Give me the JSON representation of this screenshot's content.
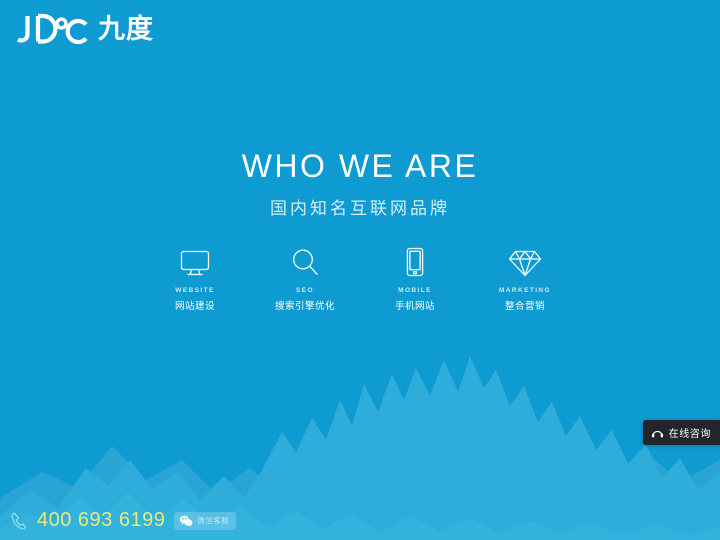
{
  "theme": {
    "background": "#0e9bd2",
    "mountain_back": "#2ba6d6",
    "mountain_front": "#2eaddb",
    "text_white": "#ffffff",
    "phone_yellow": "#e9e97a",
    "chat_panel": "#22252b"
  },
  "logo": {
    "mark_text": "JD°C",
    "mark_icon": "jdc-logo-icon",
    "cn_text": "九度"
  },
  "hero": {
    "title": "WHO WE ARE",
    "subtitle": "国内知名互联网品牌"
  },
  "services": [
    {
      "icon": "monitor-icon",
      "en": "WEBSITE",
      "cn": "网站建设"
    },
    {
      "icon": "search-icon",
      "en": "SEO",
      "cn": "搜索引擎优化"
    },
    {
      "icon": "mobile-icon",
      "en": "MOBILE",
      "cn": "手机网站"
    },
    {
      "icon": "diamond-icon",
      "en": "MARKETING",
      "cn": "整合营销"
    }
  ],
  "bottom_bar": {
    "phone_icon": "phone-icon",
    "phone_number": "400 693 6199",
    "wechat_icon": "wechat-icon",
    "wechat_label": "微信客服"
  },
  "chat_widget": {
    "icon": "headset-icon",
    "label": "在线咨询"
  }
}
